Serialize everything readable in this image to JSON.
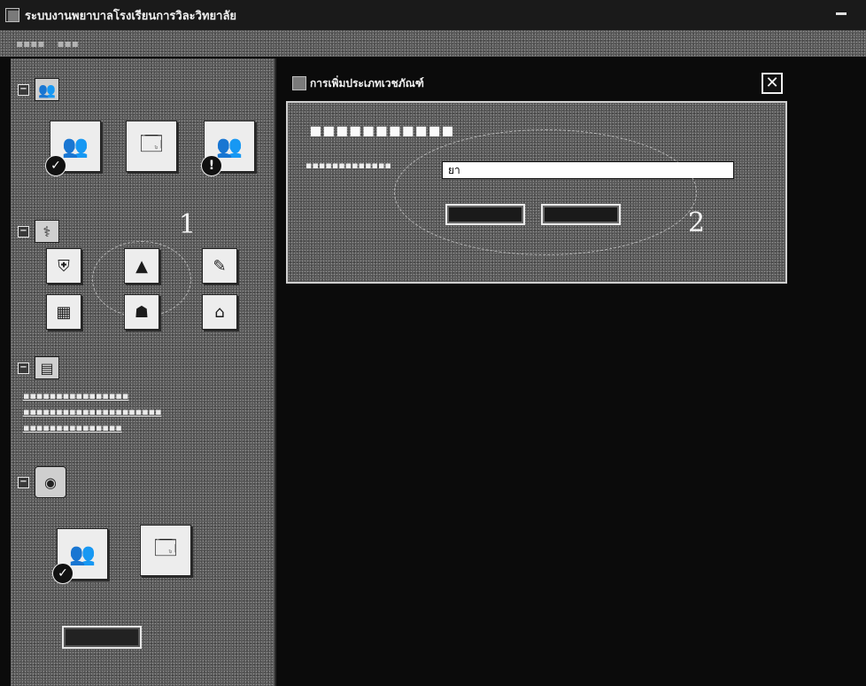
{
  "window": {
    "title": "ระบบงานพยาบาลโรงเรียนการวิละวิทยาลัย"
  },
  "sidebar": {
    "annotation_1": "1"
  },
  "dialog": {
    "title": "การเพิ่มประเภทเวชภัณฑ์",
    "close_label": "✕",
    "input_value": "ยา",
    "annotation_2": "2"
  },
  "icons": {
    "window": "app-window-icon",
    "close": "close-icon",
    "collapse": "collapse-box-icon"
  },
  "colors": {
    "background": "#0b0b0b",
    "panel": "#5a5a5a",
    "input_bg": "#ffffff"
  }
}
